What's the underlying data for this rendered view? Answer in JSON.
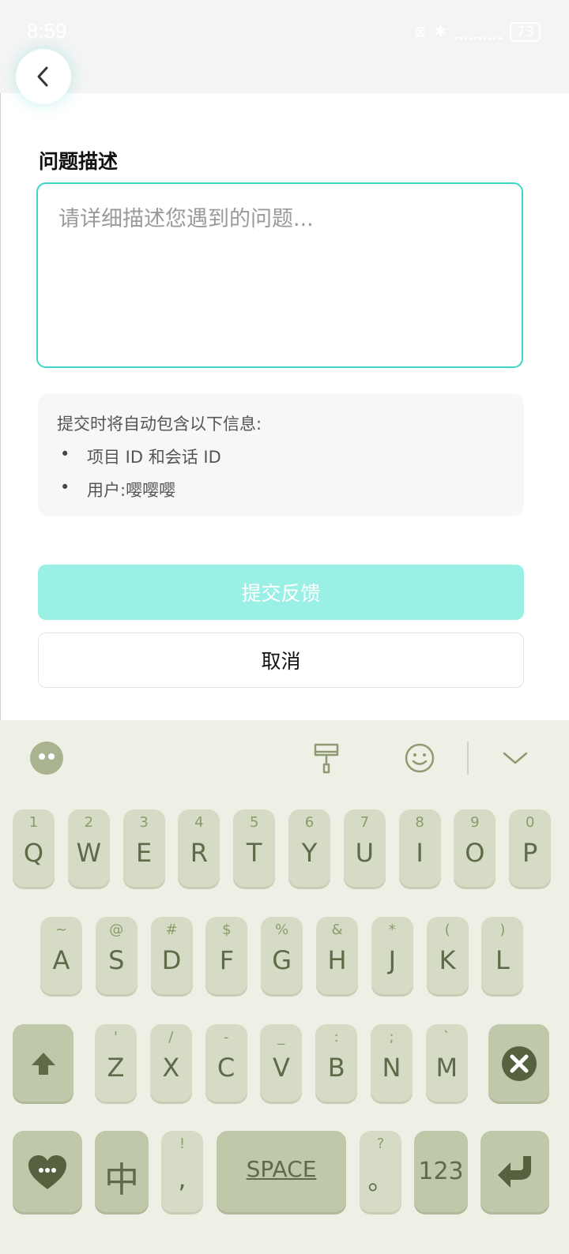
{
  "status_bar": {
    "time": "8:59",
    "battery": "73"
  },
  "form": {
    "label": "问题描述",
    "placeholder": "请详细描述您遇到的问题...",
    "info_title": "提交时将自动包含以下信息:",
    "info_items": [
      "项目 ID 和会话 ID",
      "用户:嘤嘤嘤"
    ],
    "submit_label": "提交反馈",
    "cancel_label": "取消"
  },
  "keyboard": {
    "row1": [
      {
        "sub": "1",
        "main": "Q"
      },
      {
        "sub": "2",
        "main": "W"
      },
      {
        "sub": "3",
        "main": "E"
      },
      {
        "sub": "4",
        "main": "R"
      },
      {
        "sub": "5",
        "main": "T"
      },
      {
        "sub": "6",
        "main": "Y"
      },
      {
        "sub": "7",
        "main": "U"
      },
      {
        "sub": "8",
        "main": "I"
      },
      {
        "sub": "9",
        "main": "O"
      },
      {
        "sub": "0",
        "main": "P"
      }
    ],
    "row2": [
      {
        "sub": "~",
        "main": "A"
      },
      {
        "sub": "@",
        "main": "S"
      },
      {
        "sub": "#",
        "main": "D"
      },
      {
        "sub": "$",
        "main": "F"
      },
      {
        "sub": "%",
        "main": "G"
      },
      {
        "sub": "&",
        "main": "H"
      },
      {
        "sub": "*",
        "main": "J"
      },
      {
        "sub": "(",
        "main": "K"
      },
      {
        "sub": ")",
        "main": "L"
      }
    ],
    "row3": [
      {
        "sub": "'",
        "main": "Z"
      },
      {
        "sub": "/",
        "main": "X"
      },
      {
        "sub": "-",
        "main": "C"
      },
      {
        "sub": "_",
        "main": "V"
      },
      {
        "sub": ":",
        "main": "B"
      },
      {
        "sub": ";",
        "main": "N"
      },
      {
        "sub": "`",
        "main": "M"
      }
    ],
    "lang_label": "中",
    "comma_sub": "!",
    "comma_main": ",",
    "space_label": "SPACE",
    "period_sub": "?",
    "period_main": "。",
    "numbers_label": "123"
  },
  "colors": {
    "accent": "#3fd6c9",
    "submit_bg": "#9bf0e6",
    "key_bg": "#d5dbc5",
    "key_text": "#5f6b48"
  }
}
